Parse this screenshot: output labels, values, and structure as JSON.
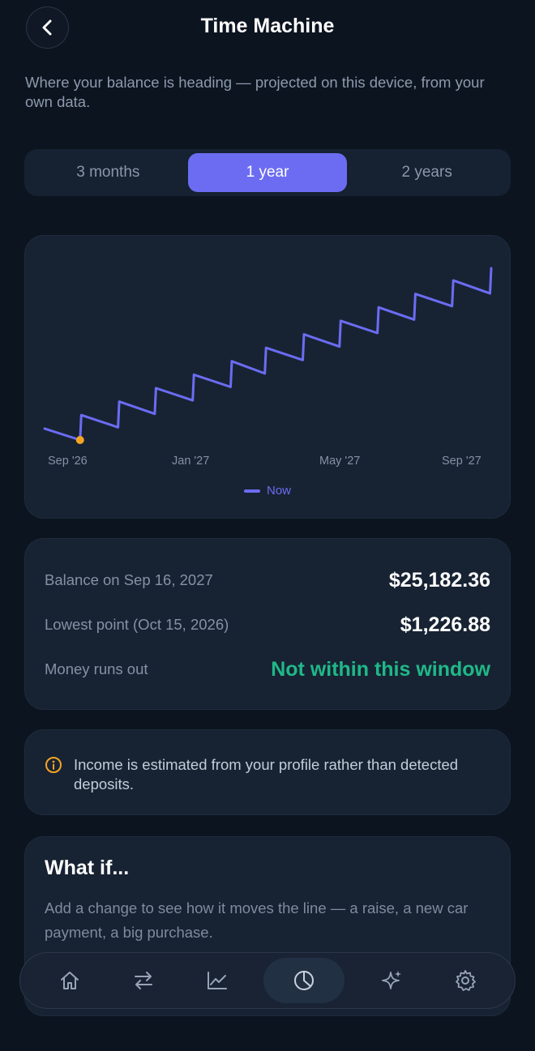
{
  "header": {
    "title": "Time Machine"
  },
  "subtitle": "Where your balance is heading — projected on this device, from your own data.",
  "range_tabs": [
    {
      "label": "3 months",
      "active": false
    },
    {
      "label": "1 year",
      "active": true
    },
    {
      "label": "2 years",
      "active": false
    }
  ],
  "chart_data": {
    "type": "line",
    "x_ticks": [
      "Sep '26",
      "Jan '27",
      "May '27",
      "Sep '27"
    ],
    "series": [
      {
        "name": "Now",
        "color": "#6c6cf2",
        "points": [
          {
            "x": "2026-09-16",
            "y": 3100
          },
          {
            "x": "2026-10-15",
            "y": 1226.88
          },
          {
            "x": "2026-10-16",
            "y": 5300
          },
          {
            "x": "2026-11-15",
            "y": 3300
          },
          {
            "x": "2026-11-16",
            "y": 7500
          },
          {
            "x": "2026-12-15",
            "y": 5500
          },
          {
            "x": "2026-12-16",
            "y": 9700
          },
          {
            "x": "2027-01-15",
            "y": 7700
          },
          {
            "x": "2027-01-16",
            "y": 11900
          },
          {
            "x": "2027-02-15",
            "y": 9900
          },
          {
            "x": "2027-02-16",
            "y": 14100
          },
          {
            "x": "2027-03-15",
            "y": 12100
          },
          {
            "x": "2027-03-16",
            "y": 16300
          },
          {
            "x": "2027-04-15",
            "y": 14300
          },
          {
            "x": "2027-04-16",
            "y": 18500
          },
          {
            "x": "2027-05-15",
            "y": 16500
          },
          {
            "x": "2027-05-16",
            "y": 20700
          },
          {
            "x": "2027-06-15",
            "y": 18700
          },
          {
            "x": "2027-06-16",
            "y": 22900
          },
          {
            "x": "2027-07-15",
            "y": 20900
          },
          {
            "x": "2027-07-16",
            "y": 25100
          },
          {
            "x": "2027-08-15",
            "y": 23100
          },
          {
            "x": "2027-08-16",
            "y": 27300
          },
          {
            "x": "2027-09-15",
            "y": 25182.36
          },
          {
            "x": "2027-09-16",
            "y": 29300
          }
        ]
      }
    ],
    "marker": {
      "x": "2026-10-15",
      "y": 1226.88,
      "color": "#f5a524"
    },
    "legend": "bottom-center",
    "grid": false
  },
  "stats": [
    {
      "label": "Balance on Sep 16, 2027",
      "value": "$25,182.36"
    },
    {
      "label": "Lowest point (Oct 15, 2026)",
      "value": "$1,226.88"
    },
    {
      "label": "Money runs out",
      "value": "Not within this window"
    }
  ],
  "notice": {
    "text": "Income is estimated from your profile rather than detected deposits."
  },
  "what_if": {
    "title": "What if...",
    "description": "Add a change to see how it moves the line — a raise, a new car payment, a big purchase."
  },
  "tabbar": [
    {
      "icon": "home-icon"
    },
    {
      "icon": "transfer-arrows-icon"
    },
    {
      "icon": "trend-chart-icon"
    },
    {
      "icon": "pie-chart-icon"
    },
    {
      "icon": "sparkle-icon"
    },
    {
      "icon": "gear-icon"
    }
  ]
}
